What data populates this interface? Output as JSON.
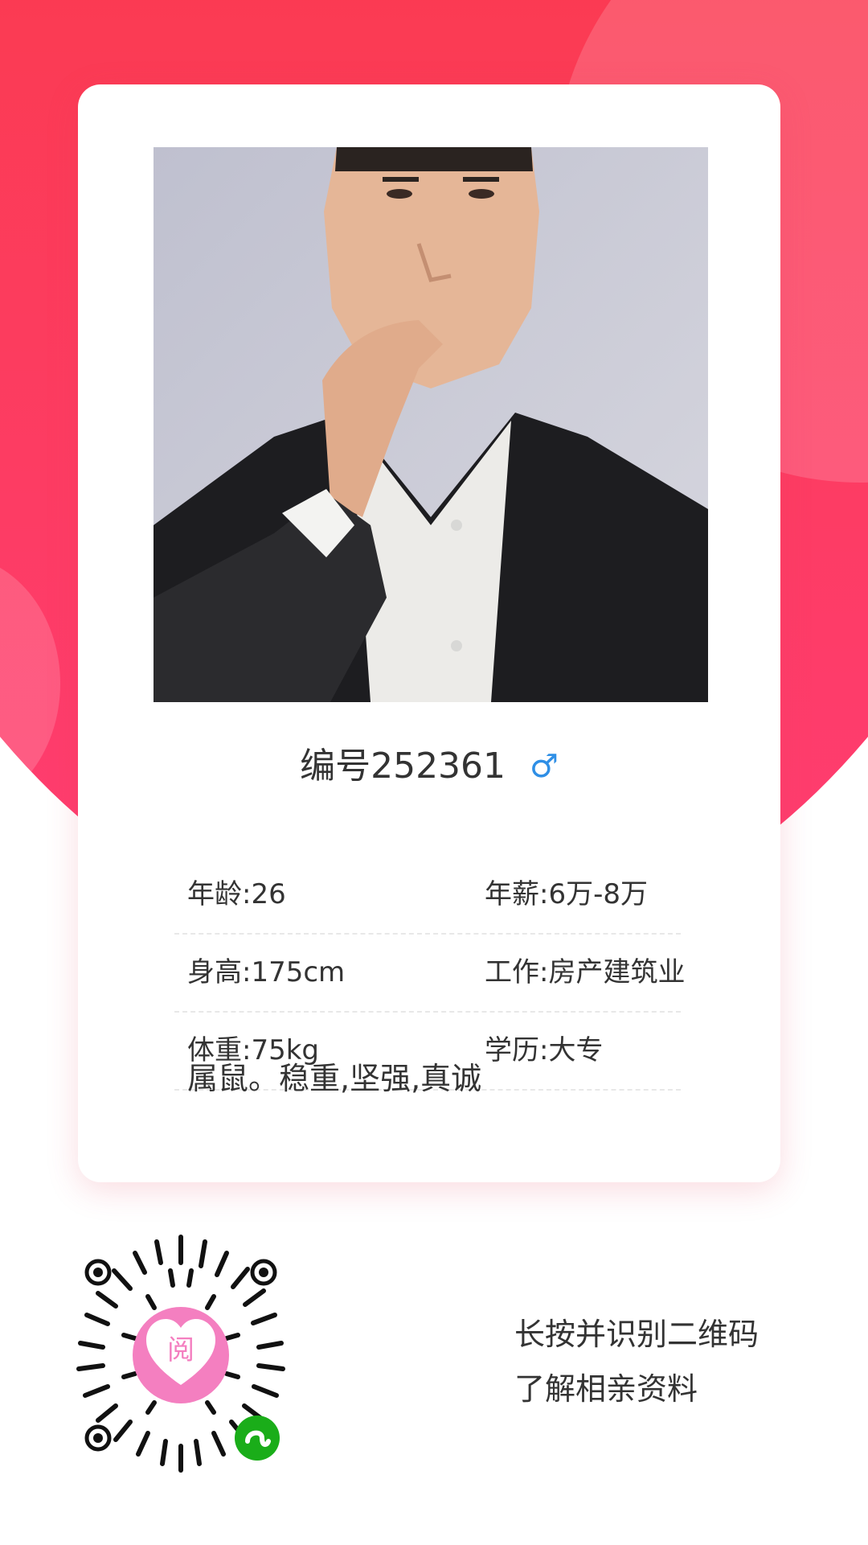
{
  "profile": {
    "title": "编号252361",
    "gender_symbol": "♂",
    "photo_icon": "portrait-photo",
    "rows": [
      {
        "left": "年龄:26",
        "right": "年薪:6万-8万"
      },
      {
        "left": "身高:175cm",
        "right": "工作:房产建筑业"
      },
      {
        "left": "体重:75kg",
        "right": "学历:大专"
      }
    ],
    "intro": "属鼠。稳重,坚强,真诚"
  },
  "qr": {
    "center_glyph": "阅",
    "line1": "长按并识别二维码",
    "line2": "了解相亲资料"
  },
  "colors": {
    "background_top": "#f62d34",
    "background_bottom": "#ff3d73",
    "accent_blue": "#2f8fe6",
    "qr_center_pink": "#f47fc0",
    "mini_program_green": "#1aad19"
  }
}
